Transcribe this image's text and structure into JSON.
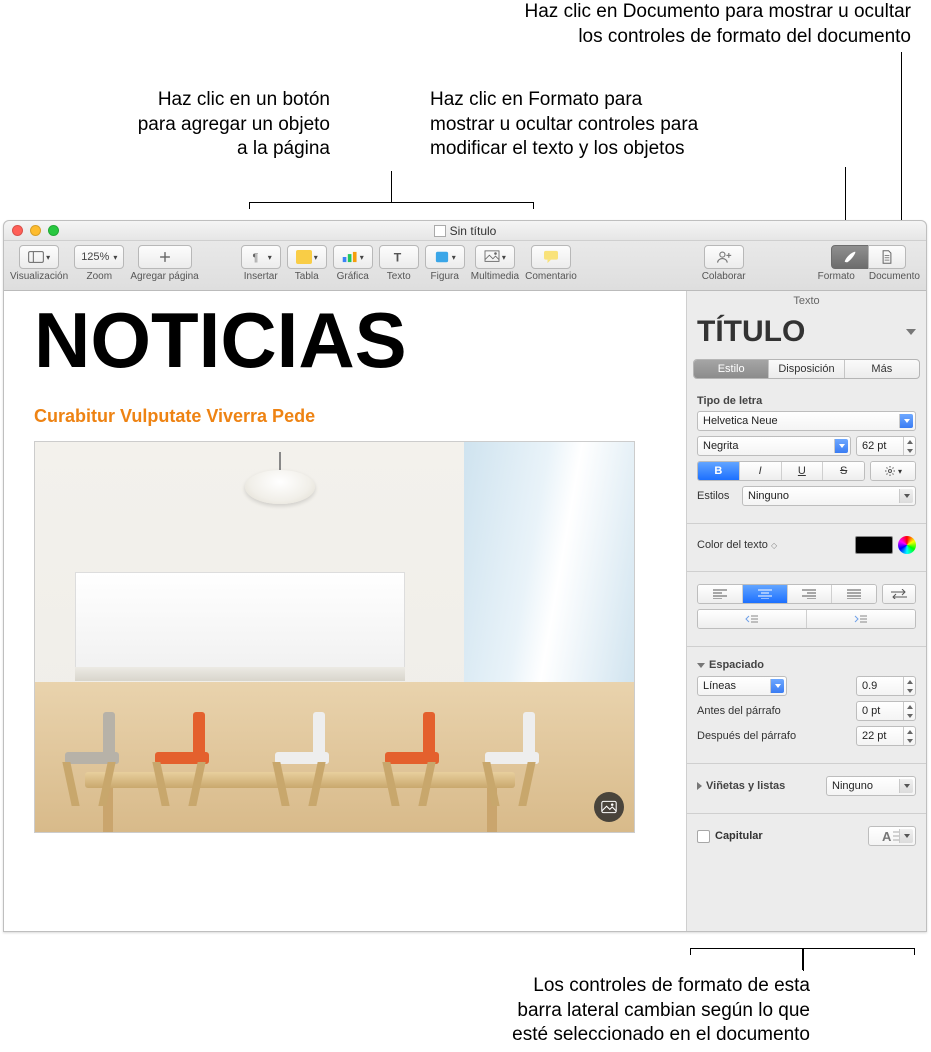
{
  "callouts": {
    "top_right_1": "Haz clic en Documento para mostrar u ocultar\nlos controles de formato del documento",
    "top_left": "Haz clic en un botón\npara agregar un objeto\na la página",
    "top_right_2": "Haz clic en Formato para\nmostrar u ocultar controles para\nmodificar el texto y los objetos",
    "bottom": "Los controles de formato de esta\nbarra lateral cambian según lo que\nesté seleccionado en el documento"
  },
  "titlebar": {
    "doc_name": "Sin título"
  },
  "toolbar": {
    "view": "Visualización",
    "zoom_value": "125%",
    "zoom": "Zoom",
    "addpage": "Agregar página",
    "insert": "Insertar",
    "table": "Tabla",
    "chart": "Gráfica",
    "text": "Texto",
    "shape": "Figura",
    "media": "Multimedia",
    "comment": "Comentario",
    "collab": "Colaborar",
    "format": "Formato",
    "document": "Documento"
  },
  "doc": {
    "headline": "NOTICIAS",
    "subhead": "Curabitur Vulputate Viverra Pede"
  },
  "sidebar": {
    "header": "Texto",
    "paragraph_style": "TÍTULO",
    "tabs": {
      "style": "Estilo",
      "layout": "Disposición",
      "more": "Más"
    },
    "font_section": "Tipo de letra",
    "font_family": "Helvetica Neue",
    "font_weight": "Negrita",
    "font_size": "62 pt",
    "B": "B",
    "I": "I",
    "U": "U",
    "S": "S",
    "styles_label": "Estilos",
    "styles_value": "Ninguno",
    "textcolor_label": "Color del texto",
    "spacing_section": "Espaciado",
    "lines_label": "Líneas",
    "lines_value": "0.9",
    "before_label": "Antes del párrafo",
    "before_value": "0 pt",
    "after_label": "Después del párrafo",
    "after_value": "22 pt",
    "bullets_label": "Viñetas y listas",
    "bullets_value": "Ninguno",
    "dropcap_label": "Capitular"
  }
}
